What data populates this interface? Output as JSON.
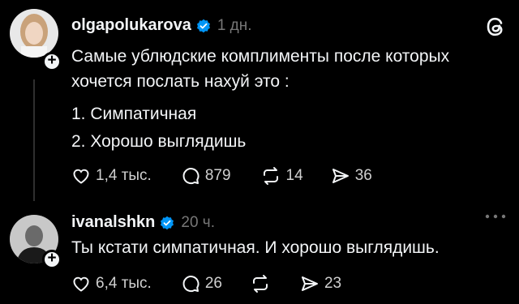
{
  "post1": {
    "username": "olgapolukarova",
    "time": "1 дн.",
    "line1": "Самые ублюдские комплименты после которых",
    "line2": "хочется послать нахуй это :",
    "item1": "1. Симпатичная",
    "item2": "2. Хорошо выглядишь",
    "likes": "1,4 тыс.",
    "comments": "879",
    "reposts": "14",
    "shares": "36"
  },
  "post2": {
    "username": "ivanalshkn",
    "time": "20 ч.",
    "text": "Ты кстати симпатичная. И хорошо выглядишь.",
    "likes": "6,4 тыс.",
    "comments": "26",
    "shares": "23"
  },
  "colors": {
    "background": "#000000",
    "text": "#f3f5f7",
    "muted": "#777777",
    "verified": "#0095f6"
  },
  "icons": [
    "threads-logo-icon",
    "verified-icon",
    "heart-icon",
    "comment-icon",
    "repost-icon",
    "share-icon",
    "more-icon",
    "plus-icon"
  ]
}
